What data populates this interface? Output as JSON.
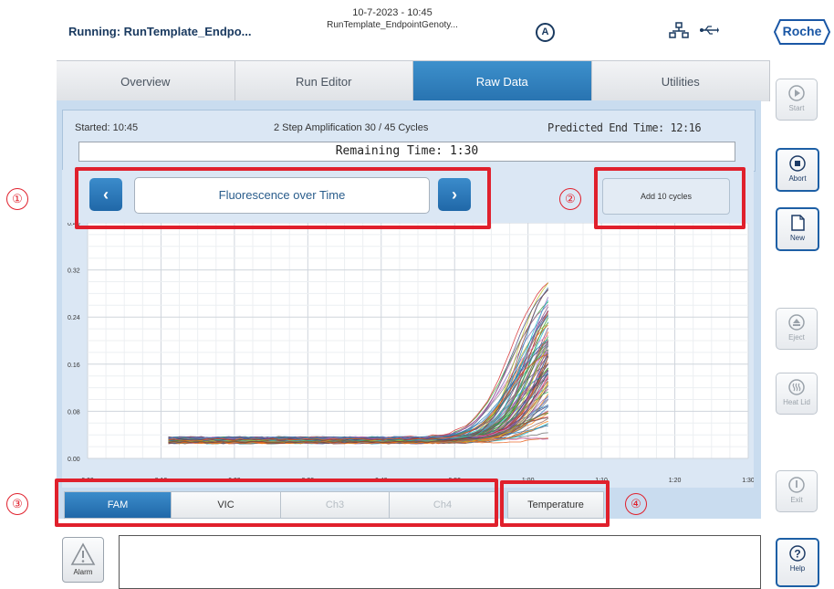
{
  "header": {
    "title": "Running: RunTemplate_Endpo...",
    "datetime": "10-7-2023 - 10:45",
    "template": "RunTemplate_EndpointGenoty...",
    "status_icon_letter": "A",
    "brand": "Roche"
  },
  "tabs": [
    {
      "label": "Overview",
      "active": false
    },
    {
      "label": "Run Editor",
      "active": false
    },
    {
      "label": "Raw Data",
      "active": true
    },
    {
      "label": "Utilities",
      "active": false
    }
  ],
  "run_info": {
    "started": "Started: 10:45",
    "step": "2 Step Amplification 30 / 45 Cycles",
    "predicted_end": "Predicted End Time: 12:16",
    "remaining": "Remaining Time: 1:30"
  },
  "view": {
    "title": "Fluorescence over Time",
    "prev_symbol": "‹",
    "next_symbol": "›",
    "add_cycles": "Add 10 cycles"
  },
  "channels": [
    {
      "label": "FAM",
      "state": "active"
    },
    {
      "label": "VIC",
      "state": "normal"
    },
    {
      "label": "Ch3",
      "state": "disabled"
    },
    {
      "label": "Ch4",
      "state": "disabled"
    },
    {
      "label": "Temperature",
      "state": "normal"
    }
  ],
  "side_buttons": [
    {
      "label": "Start",
      "enabled": false,
      "icon": "play-icon"
    },
    {
      "label": "Abort",
      "enabled": true,
      "icon": "stop-icon"
    },
    {
      "label": "New",
      "enabled": true,
      "icon": "document-icon"
    },
    {
      "label": "Eject",
      "enabled": false,
      "icon": "eject-icon"
    },
    {
      "label": "Heat Lid",
      "enabled": false,
      "icon": "heat-icon"
    },
    {
      "label": "Exit",
      "enabled": false,
      "icon": "power-icon"
    },
    {
      "label": "Help",
      "enabled": true,
      "icon": "help-icon"
    }
  ],
  "alarm": {
    "label": "Alarm",
    "icon": "warning-icon"
  },
  "annotations": [
    "①",
    "②",
    "③",
    "④"
  ],
  "colors": {
    "accent": "#2873b0",
    "highlight": "#e0202c",
    "panel": "#c9dcef"
  },
  "chart_data": {
    "type": "line",
    "title": "",
    "xlabel": "",
    "ylabel": "",
    "x_ticks": [
      "0:00",
      "0:10",
      "0:20",
      "0:30",
      "0:40",
      "0:50",
      "1:00",
      "1:10",
      "1:20",
      "1:30"
    ],
    "y_ticks": [
      "0.00",
      "0.08",
      "0.16",
      "0.24",
      "0.32",
      "0.40"
    ],
    "xlim_minutes": [
      0,
      90
    ],
    "ylim": [
      0,
      0.4
    ],
    "grid": true,
    "series_count": 96,
    "baseline_range": [
      0.026,
      0.036
    ],
    "plateau_range": [
      0.025,
      0.33
    ],
    "rise_start_minutes": 48,
    "last_point_minutes": 63,
    "series_colors": [
      "#1f77b4",
      "#d62728",
      "#2ca02c",
      "#9467bd",
      "#8c564b",
      "#e377c2",
      "#17becf",
      "#bcbd22",
      "#ff7f0e",
      "#7f7f7f",
      "#393b79",
      "#637939",
      "#843c39",
      "#7b4173",
      "#3182bd",
      "#e6550d",
      "#31a354",
      "#756bb1",
      "#636363",
      "#a55194"
    ]
  }
}
